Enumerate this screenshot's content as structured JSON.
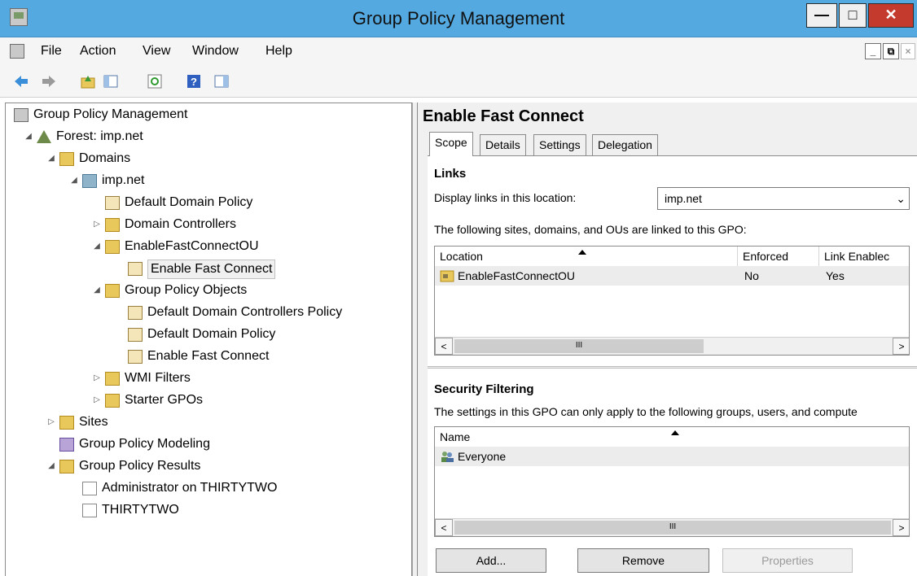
{
  "window": {
    "title": "Group Policy Management"
  },
  "menu": {
    "items": [
      "File",
      "Action",
      "View",
      "Window",
      "Help"
    ]
  },
  "tree": [
    {
      "label": "Group Policy Management",
      "depth": 0,
      "expander": "",
      "icon": "gpm"
    },
    {
      "label": "Forest: imp.net",
      "depth": 1,
      "expander": "◢",
      "icon": "forest"
    },
    {
      "label": "Domains",
      "depth": 2,
      "expander": "◢",
      "icon": "folder"
    },
    {
      "label": "imp.net",
      "depth": 3,
      "expander": "◢",
      "icon": "dom"
    },
    {
      "label": "Default Domain Policy",
      "depth": 4,
      "expander": "",
      "icon": "doc"
    },
    {
      "label": "Domain Controllers",
      "depth": 4,
      "expander": "▷",
      "icon": "folder"
    },
    {
      "label": "EnableFastConnectOU",
      "depth": 4,
      "expander": "◢",
      "icon": "folder"
    },
    {
      "label": "Enable Fast Connect",
      "depth": 5,
      "expander": "",
      "icon": "doc",
      "selected": true
    },
    {
      "label": "Group Policy Objects",
      "depth": 4,
      "expander": "◢",
      "icon": "folder"
    },
    {
      "label": "Default Domain Controllers Policy",
      "depth": 5,
      "expander": "",
      "icon": "doc"
    },
    {
      "label": "Default Domain Policy",
      "depth": 5,
      "expander": "",
      "icon": "doc"
    },
    {
      "label": "Enable Fast Connect",
      "depth": 5,
      "expander": "",
      "icon": "doc"
    },
    {
      "label": "WMI Filters",
      "depth": 4,
      "expander": "▷",
      "icon": "folder"
    },
    {
      "label": "Starter GPOs",
      "depth": 4,
      "expander": "▷",
      "icon": "folder"
    },
    {
      "label": "Sites",
      "depth": 2,
      "expander": "▷",
      "icon": "folder"
    },
    {
      "label": "Group Policy Modeling",
      "depth": 2,
      "expander": "",
      "icon": "model"
    },
    {
      "label": "Group Policy Results",
      "depth": 2,
      "expander": "◢",
      "icon": "folder"
    },
    {
      "label": "Administrator on THIRTYTWO",
      "depth": 3,
      "expander": "",
      "icon": "rep"
    },
    {
      "label": "THIRTYTWO",
      "depth": 3,
      "expander": "",
      "icon": "rep"
    }
  ],
  "details": {
    "title": "Enable Fast Connect",
    "tabs": [
      "Scope",
      "Details",
      "Settings",
      "Delegation"
    ],
    "links": {
      "heading": "Links",
      "display_label": "Display links in this location:",
      "location_value": "imp.net",
      "linked_text": "The following sites, domains, and OUs are linked to this GPO:",
      "columns": [
        "Location",
        "Enforced",
        "Link Enablec"
      ],
      "rows": [
        {
          "location": "EnableFastConnectOU",
          "enforced": "No",
          "link_enabled": "Yes"
        }
      ]
    },
    "security": {
      "heading": "Security Filtering",
      "text": "The settings in this GPO can only apply to the following groups, users, and compute",
      "column": "Name",
      "rows": [
        "Everyone"
      ]
    },
    "buttons": {
      "add": "Add...",
      "remove": "Remove",
      "properties": "Properties"
    }
  }
}
